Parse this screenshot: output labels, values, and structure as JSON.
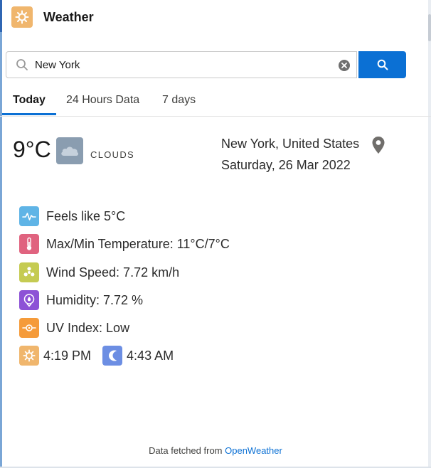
{
  "app": {
    "title": "Weather",
    "icon": "sun-icon",
    "icon_color": "#f0b66d"
  },
  "search": {
    "value": "New York",
    "placeholder": ""
  },
  "tabs": [
    {
      "label": "Today",
      "active": true
    },
    {
      "label": "24 Hours Data",
      "active": false
    },
    {
      "label": "7 days",
      "active": false
    }
  ],
  "current": {
    "temperature": "9°C",
    "condition": "CLOUDS",
    "condition_icon": "cloud-icon",
    "location": "New York, United States",
    "date": "Saturday, 26 Mar 2022"
  },
  "details": {
    "feels_like": "Feels like 5°C",
    "max_min": "Max/Min Temperature: 11°C/7°C",
    "wind": "Wind Speed: 7.72 km/h",
    "humidity": "Humidity: 7.72 %",
    "uv": "UV Index: Low",
    "sunrise": "4:19 PM",
    "sunset": "4:43 AM"
  },
  "footer": {
    "text": "Data fetched from",
    "link": "OpenWeather"
  },
  "colors": {
    "accent": "#0b70d4",
    "feels_like_tile": "#5fb4e6",
    "max_min_tile": "#e0637f",
    "wind_tile": "#c5cb52",
    "humidity_tile": "#8d52d6",
    "uv_tile": "#f59b3a",
    "sunrise_tile": "#f0b66d",
    "sunset_tile": "#6c8ee3"
  }
}
